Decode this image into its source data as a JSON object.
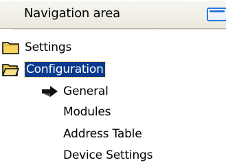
{
  "header": {
    "title": "Navigation area"
  },
  "tree": {
    "items": [
      {
        "label": "Settings",
        "type": "folder",
        "state": "closed"
      },
      {
        "label": "Configuration",
        "type": "folder",
        "state": "open",
        "selected": true
      },
      {
        "label": "General",
        "type": "page",
        "current": true
      },
      {
        "label": "Modules",
        "type": "page"
      },
      {
        "label": "Address Table",
        "type": "page"
      },
      {
        "label": "Device Settings",
        "type": "page"
      }
    ]
  },
  "colors": {
    "selection": "#0a3a8f",
    "folder_fill": "#f6d55f",
    "header_button": "#2b78d8"
  },
  "icons": {
    "closed_folder": "folder-icon",
    "open_folder": "folder-open-icon",
    "current_page": "arrow-right-icon",
    "panel_button": "window-icon"
  }
}
